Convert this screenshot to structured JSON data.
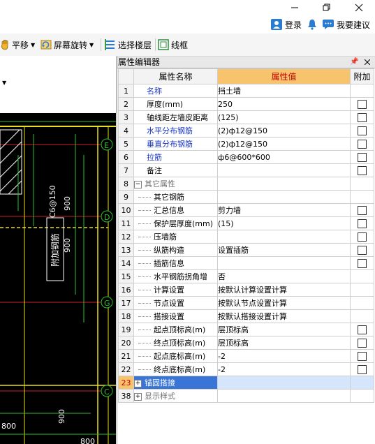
{
  "window": {
    "min_icon": "minimize-icon",
    "max_icon": "maximize-icon",
    "close_icon": "close-icon"
  },
  "topbar": {
    "login": "登录",
    "suggest": "我要建议"
  },
  "toolbar": {
    "pan": "平移",
    "rotate": "屏幕旋转",
    "select_floor": "选择楼层",
    "wireframe": "线框"
  },
  "drawing": {
    "axis_labels": [
      "E",
      "D",
      "G",
      "C"
    ],
    "dimensions": [
      "900",
      "900",
      "900",
      "800",
      "800"
    ],
    "rebar_text": "附加钢筋",
    "rebar_spec": "C6@150"
  },
  "panel": {
    "title": "属性编辑器",
    "pin_icon": "pin-icon",
    "close_icon": "close-icon",
    "headers": {
      "name": "属性名称",
      "value": "属性值",
      "extra": "附加"
    },
    "rows": [
      {
        "num": "1",
        "name": "名称",
        "value": "挡土墙",
        "blue": true,
        "check": false,
        "indent": 0
      },
      {
        "num": "2",
        "name": "厚度(mm)",
        "value": "250",
        "check": true,
        "indent": 0
      },
      {
        "num": "3",
        "name": "轴线距左墙皮距离",
        "value": "(125)",
        "check": true,
        "indent": 0
      },
      {
        "num": "4",
        "name": "水平分布钢筋",
        "value": "(2)ф12@150",
        "blue": true,
        "check": true,
        "indent": 0
      },
      {
        "num": "5",
        "name": "垂直分布钢筋",
        "value": "(2)ф12@150",
        "blue": true,
        "check": true,
        "indent": 0
      },
      {
        "num": "6",
        "name": "拉筋",
        "value": "ф6@600*600",
        "blue": true,
        "check": true,
        "indent": 0
      },
      {
        "num": "7",
        "name": "备注",
        "value": "",
        "check": true,
        "indent": 0
      },
      {
        "num": "8",
        "name": "其它属性",
        "value": "",
        "group": "minus",
        "grey": true,
        "check": false,
        "indent": 0
      },
      {
        "num": "9",
        "name": "其它钢筋",
        "value": "",
        "check": false,
        "indent": 1
      },
      {
        "num": "10",
        "name": "汇总信息",
        "value": "剪力墙",
        "check": true,
        "indent": 1
      },
      {
        "num": "11",
        "name": "保护层厚度(mm)",
        "value": "(15)",
        "check": true,
        "indent": 1
      },
      {
        "num": "12",
        "name": "压墙筋",
        "value": "",
        "check": true,
        "indent": 1
      },
      {
        "num": "13",
        "name": "纵筋构造",
        "value": "设置插筋",
        "check": true,
        "indent": 1
      },
      {
        "num": "14",
        "name": "插筋信息",
        "value": "",
        "check": true,
        "indent": 1
      },
      {
        "num": "15",
        "name": "水平钢筋拐角增",
        "value": "否",
        "check": false,
        "indent": 1
      },
      {
        "num": "16",
        "name": "计算设置",
        "value": "按默认计算设置计算",
        "check": false,
        "indent": 1
      },
      {
        "num": "17",
        "name": "节点设置",
        "value": "按默认节点设置计算",
        "check": false,
        "indent": 1
      },
      {
        "num": "18",
        "name": "搭接设置",
        "value": "按默认搭接设置计算",
        "check": false,
        "indent": 1
      },
      {
        "num": "19",
        "name": "起点顶标高(m)",
        "value": "层顶标高",
        "check": true,
        "indent": 1
      },
      {
        "num": "20",
        "name": "终点顶标高(m)",
        "value": "层顶标高",
        "check": true,
        "indent": 1
      },
      {
        "num": "21",
        "name": "起点底标高(m)",
        "value": "-2",
        "check": true,
        "indent": 1
      },
      {
        "num": "22",
        "name": "终点底标高(m)",
        "value": "-2",
        "check": true,
        "indent": 1
      },
      {
        "num": "23",
        "name": "锚固搭接",
        "value": "",
        "group": "plus",
        "selected": true,
        "check": false,
        "indent": 0
      },
      {
        "num": "38",
        "name": "显示样式",
        "value": "",
        "group": "plus",
        "grey": true,
        "check": false,
        "indent": 0
      }
    ]
  },
  "colors": {
    "accent": "#3875d7",
    "header_value": "#f7c46d",
    "blue_text": "#1a36c8"
  }
}
